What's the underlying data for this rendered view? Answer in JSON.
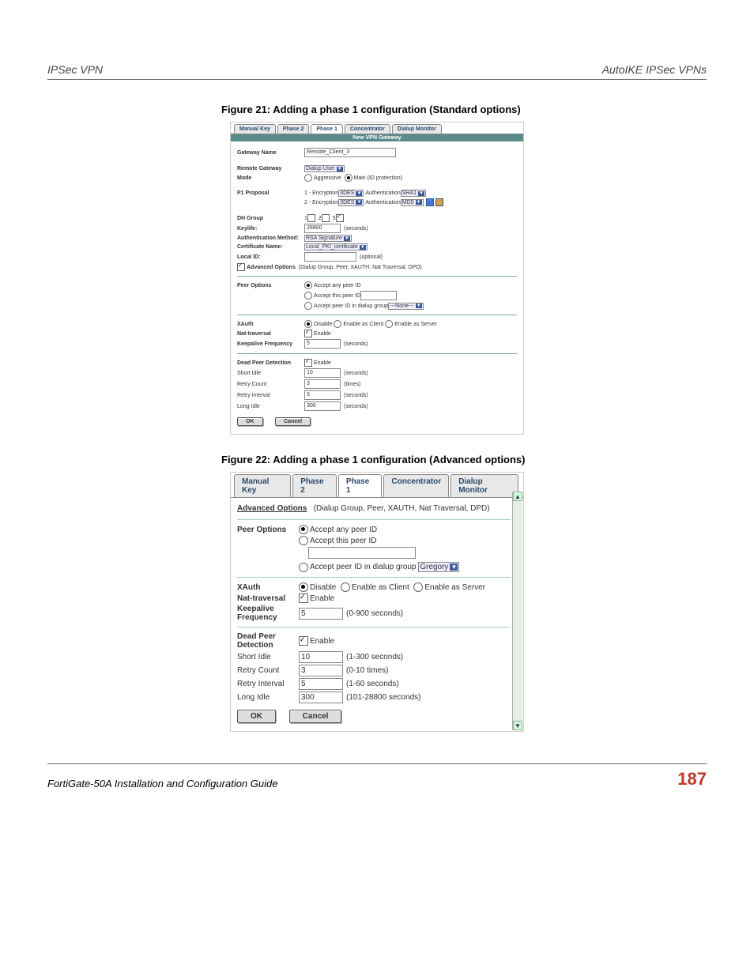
{
  "header": {
    "left": "IPSec VPN",
    "right": "AutoIKE IPSec VPNs"
  },
  "fig21_caption": "Figure 21: Adding a phase 1 configuration (Standard options)",
  "fig22_caption": "Figure 22: Adding a phase 1 configuration (Advanced options)",
  "tabs": {
    "manual_key": "Manual Key",
    "phase2": "Phase 2",
    "phase1": "Phase 1",
    "concentrator": "Concentrator",
    "dialup_monitor": "Dialup Monitor"
  },
  "fig21": {
    "bar": "New VPN Gateway",
    "gateway_name_label": "Gateway Name",
    "gateway_name_value": "Remote_Client_3",
    "remote_gateway_label": "Remote Gateway",
    "remote_gateway_value": "Dialup User",
    "mode_label": "Mode",
    "mode_aggressive": "Aggressive",
    "mode_main": "Main (ID protection)",
    "p1_proposal_label": "P1 Proposal",
    "enc1_label": "1 - Encryption",
    "enc2_label": "2 - Encryption",
    "enc_val": "3DES",
    "auth_label": "Authentication",
    "auth_val1": "SHA1",
    "auth_val2": "MD5",
    "dh_group_label": "DH Group",
    "dh1": "1",
    "dh2": "2",
    "dh5": "5",
    "keylife_label": "Keylife:",
    "keylife_value": "28800",
    "keylife_unit": "(seconds)",
    "auth_method_label": "Authentication Method:",
    "auth_method_value": "RSA Signature",
    "cert_name_label": "Certificate Name:",
    "cert_name_value": "Local_PKI_certificate",
    "local_id_label": "Local ID:",
    "local_id_hint": "(optional)",
    "adv_opt_label": "Advanced Options",
    "adv_opt_hint": "(Dialup Group, Peer, XAUTH, Nat Traversal, DPD)",
    "peer_options_label": "Peer Options",
    "peer_any": "Accept any peer ID",
    "peer_this": "Accept this peer ID",
    "peer_dialup": "Accept peer ID in dialup group",
    "peer_dialup_value": "---None---",
    "xauth_label": "XAuth",
    "xauth_disable": "Disable",
    "xauth_client": "Enable as Client",
    "xauth_server": "Enable as Server",
    "nat_label": "Nat-traversal",
    "enable_label": "Enable",
    "keepalive_label": "Keepalive Frequency",
    "keepalive_value": "5",
    "keepalive_unit": "(seconds)",
    "dpd_label": "Dead Peer Detection",
    "short_idle_label": "Short Idle",
    "short_idle_value": "10",
    "short_idle_unit": "(seconds)",
    "retry_count_label": "Retry Count",
    "retry_count_value": "3",
    "retry_count_unit": "(times)",
    "retry_interval_label": "Retry Interval",
    "retry_interval_value": "5",
    "retry_interval_unit": "(seconds)",
    "long_idle_label": "Long Idle",
    "long_idle_value": "300",
    "long_idle_unit": "(seconds)",
    "ok": "OK",
    "cancel": "Cancel"
  },
  "fig22": {
    "adv_opt_head": "Advanced Options",
    "adv_opt_hint": "(Dialup Group, Peer, XAUTH, Nat Traversal, DPD)",
    "peer_options_label": "Peer Options",
    "peer_any": "Accept any peer ID",
    "peer_this": "Accept this peer ID",
    "peer_dialup": "Accept peer ID in dialup group",
    "peer_dialup_value": "Gregory",
    "xauth_label": "XAuth",
    "xauth_disable": "Disable",
    "xauth_client": "Enable as Client",
    "xauth_server": "Enable as Server",
    "nat_label": "Nat-traversal",
    "enable_label": "Enable",
    "keepalive_label": "Keepalive Frequency",
    "keepalive_value": "5",
    "keepalive_unit": "(0-900 seconds)",
    "dpd_label": "Dead Peer Detection",
    "short_idle_label": "Short Idle",
    "short_idle_value": "10",
    "short_idle_unit": "(1-300 seconds)",
    "retry_count_label": "Retry Count",
    "retry_count_value": "3",
    "retry_count_unit": "(0-10 times)",
    "retry_interval_label": "Retry Interval",
    "retry_interval_value": "5",
    "retry_interval_unit": "(1-60 seconds)",
    "long_idle_label": "Long Idle",
    "long_idle_value": "300",
    "long_idle_unit": "(101-28800 seconds)",
    "ok": "OK",
    "cancel": "Cancel"
  },
  "footer": {
    "left": "FortiGate-50A Installation and Configuration Guide",
    "right": "187"
  }
}
